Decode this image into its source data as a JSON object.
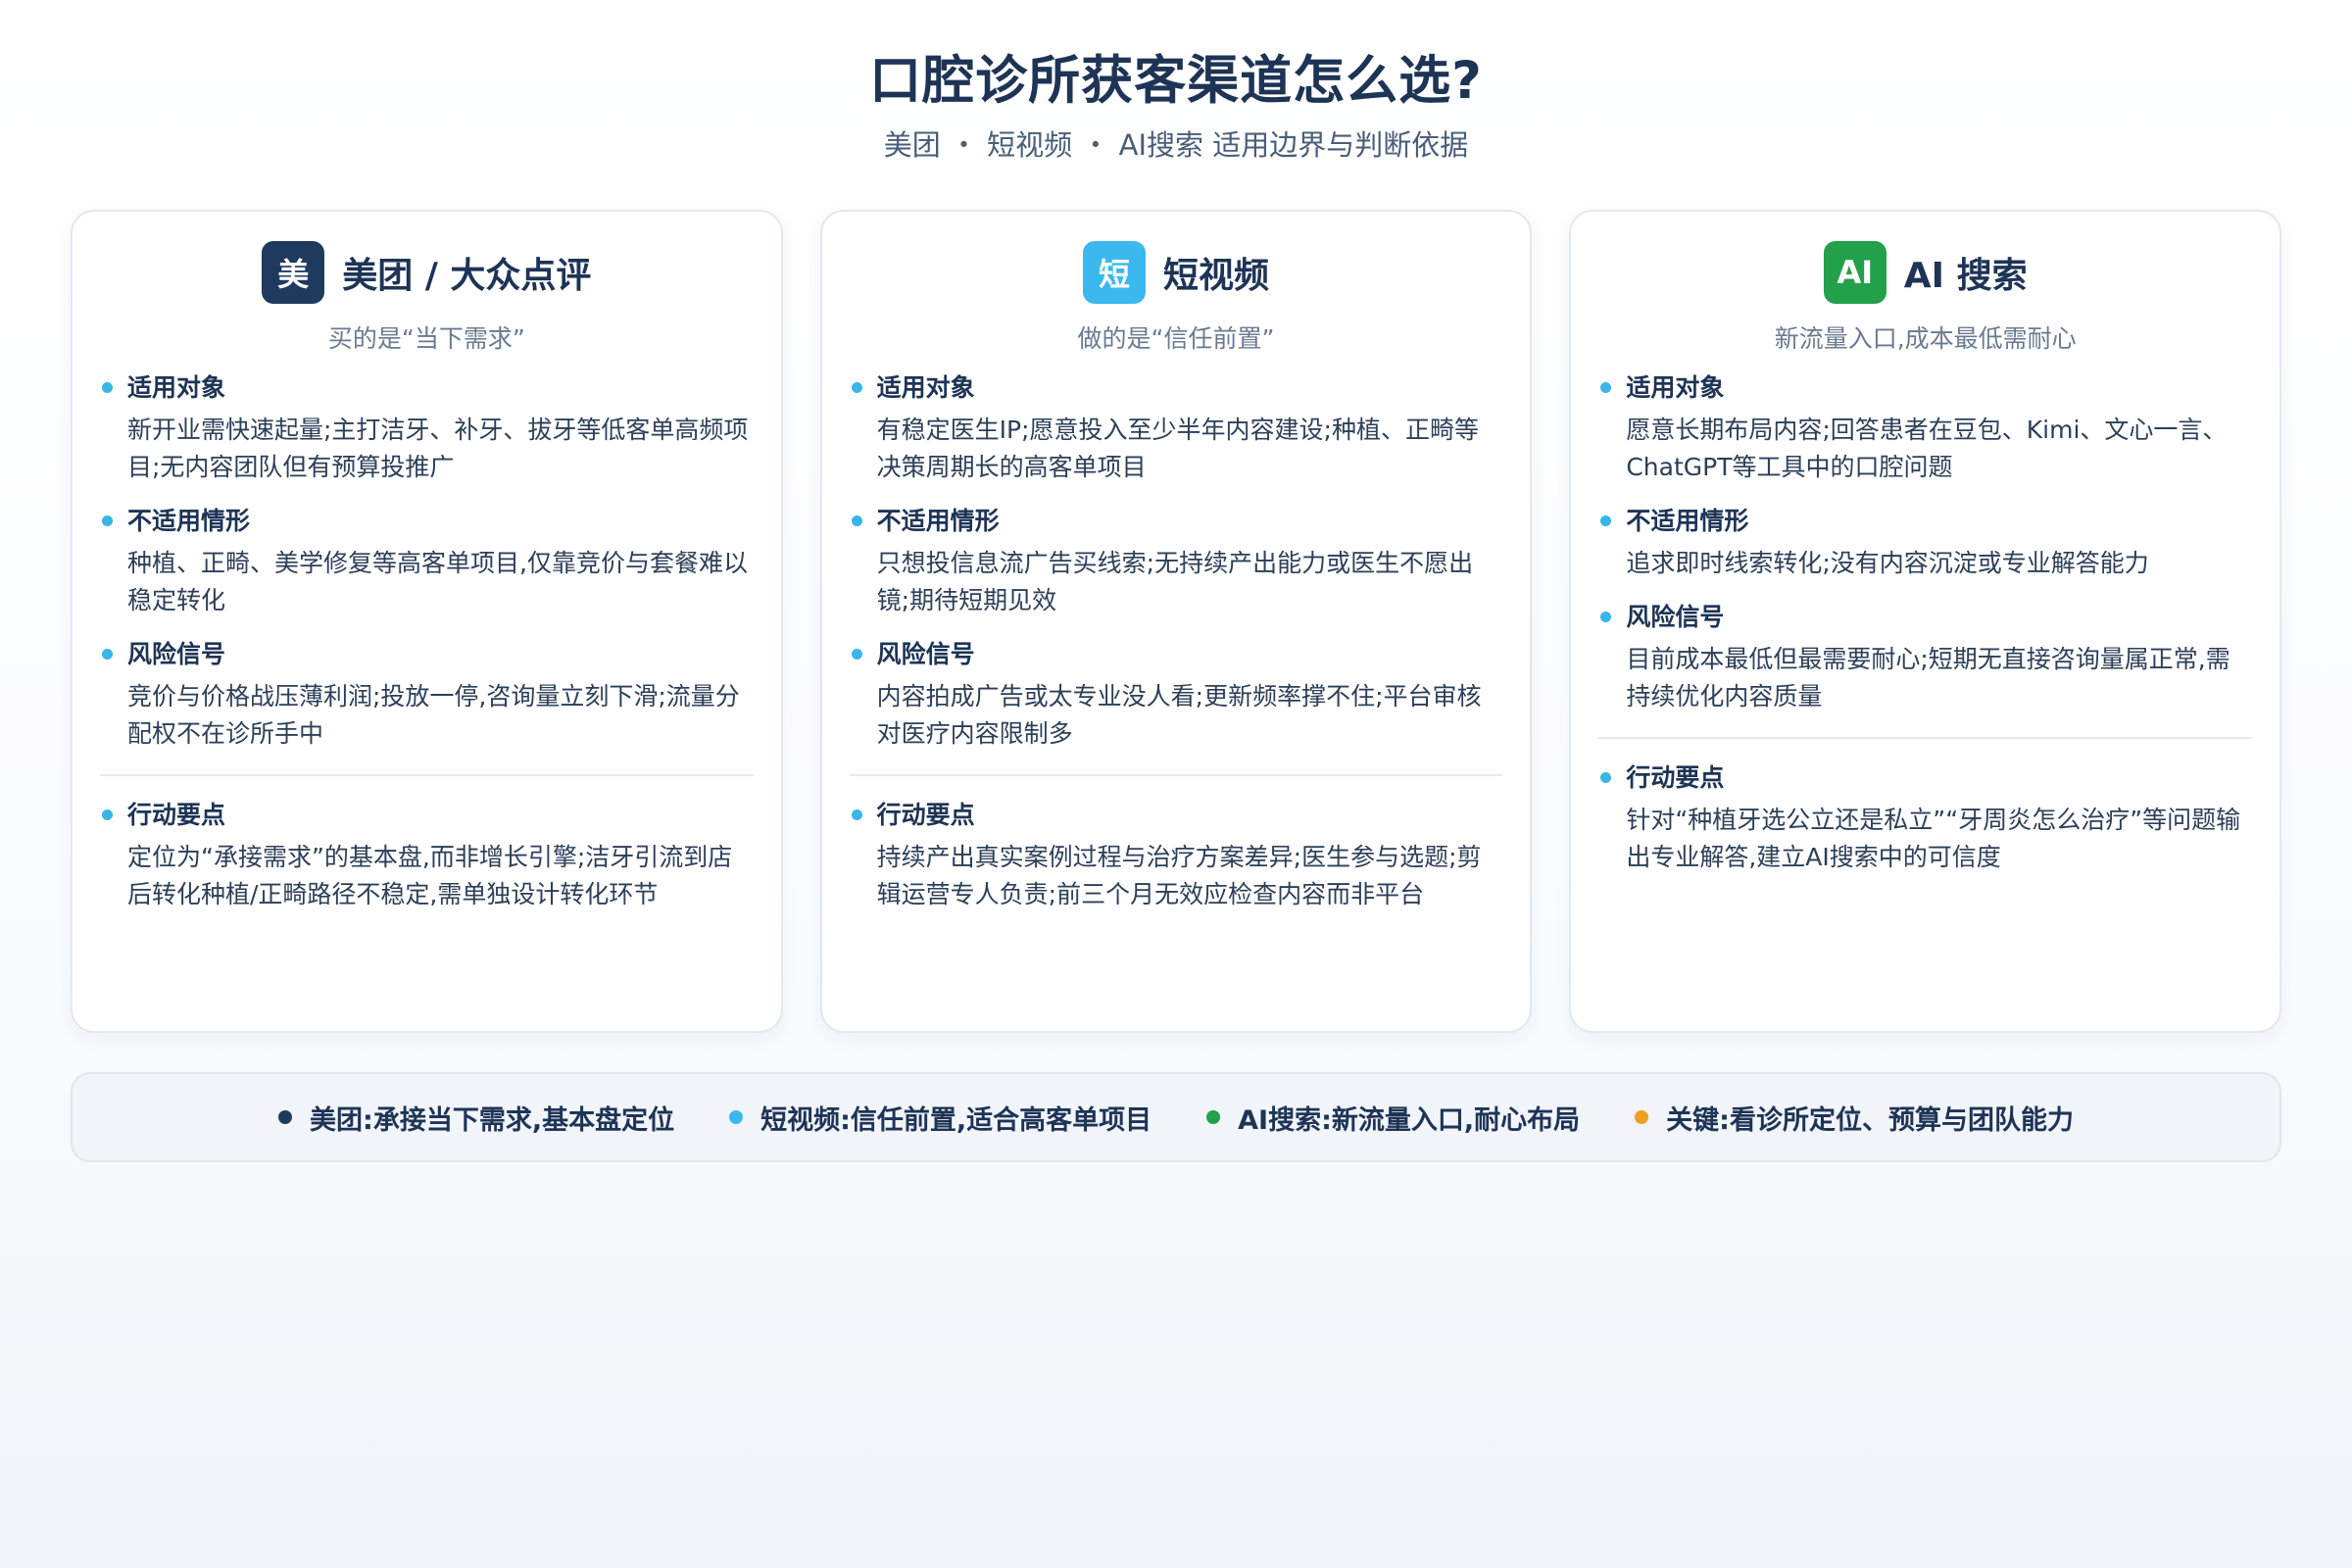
{
  "header": {
    "title": "口腔诊所获客渠道怎么选?",
    "subtitle": "美团 ・ 短视频 ・ AI搜索 适用边界与判断依据"
  },
  "cards": [
    {
      "badge": "美",
      "badge_color": "#1e3a5f",
      "title": "美团 / 大众点评",
      "subtitle": "买的是“当下需求”",
      "sections": [
        {
          "title": "适用对象",
          "text": "新开业需快速起量;主打洁牙、补牙、拔牙等低客单高频项目;无内容团队但有预算投推广"
        },
        {
          "title": "不适用情形",
          "text": "种植、正畸、美学修复等高客单项目,仅靠竞价与套餐难以稳定转化"
        },
        {
          "title": "风险信号",
          "text": "竞价与价格战压薄利润;投放一停,咨询量立刻下滑;流量分配权不在诊所手中"
        }
      ],
      "action": {
        "title": "行动要点",
        "text": "定位为“承接需求”的基本盘,而非增长引擎;洁牙引流到店后转化种植/正畸路径不稳定,需单独设计转化环节"
      }
    },
    {
      "badge": "短",
      "badge_color": "#3bb8ee",
      "title": "短视频",
      "subtitle": "做的是“信任前置”",
      "sections": [
        {
          "title": "适用对象",
          "text": "有稳定医生IP;愿意投入至少半年内容建设;种植、正畸等决策周期长的高客单项目"
        },
        {
          "title": "不适用情形",
          "text": "只想投信息流广告买线索;无持续产出能力或医生不愿出镜;期待短期见效"
        },
        {
          "title": "风险信号",
          "text": "内容拍成广告或太专业没人看;更新频率撑不住;平台审核对医疗内容限制多"
        }
      ],
      "action": {
        "title": "行动要点",
        "text": "持续产出真实案例过程与治疗方案差异;医生参与选题;剪辑运营专人负责;前三个月无效应检查内容而非平台"
      }
    },
    {
      "badge": "AI",
      "badge_color": "#22a04a",
      "title": "AI 搜索",
      "subtitle": "新流量入口,成本最低需耐心",
      "sections": [
        {
          "title": "适用对象",
          "text": "愿意长期布局内容;回答患者在豆包、Kimi、文心一言、ChatGPT等工具中的口腔问题"
        },
        {
          "title": "不适用情形",
          "text": "追求即时线索转化;没有内容沉淀或专业解答能力"
        },
        {
          "title": "风险信号",
          "text": "目前成本最低但最需要耐心;短期无直接咨询量属正常,需持续优化内容质量"
        }
      ],
      "action": {
        "title": "行动要点",
        "text": "针对“种植牙选公立还是私立”“牙周炎怎么治疗”等问题输出专业解答,建立AI搜索中的可信度"
      }
    }
  ],
  "bullet_color": "#38b6e8",
  "footer": [
    {
      "text": "美团:承接当下需求,基本盘定位",
      "color": "#1e3a5f"
    },
    {
      "text": "短视频:信任前置,适合高客单项目",
      "color": "#3bb8ee"
    },
    {
      "text": "AI搜索:新流量入口,耐心布局",
      "color": "#22a04a"
    },
    {
      "text": "关键:看诊所定位、预算与团队能力",
      "color": "#f0a020"
    }
  ]
}
